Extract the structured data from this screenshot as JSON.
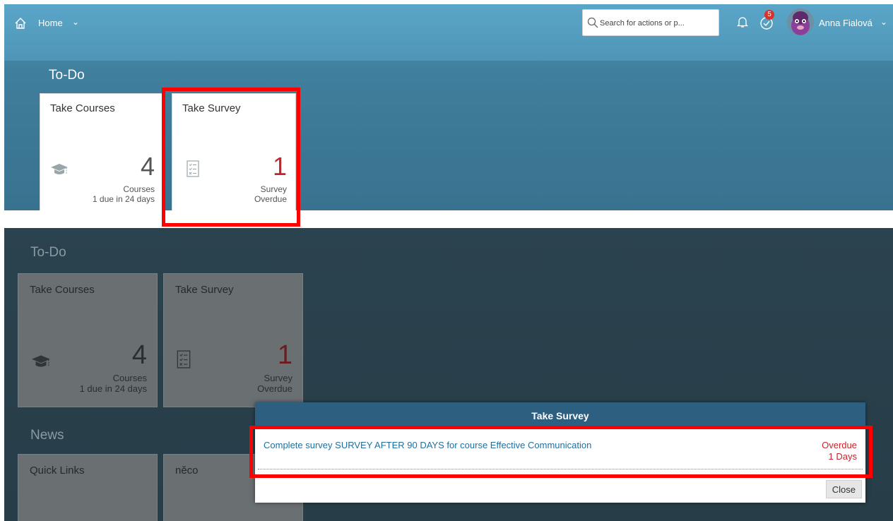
{
  "shell": {
    "home_label": "Home",
    "search_placeholder": "Search for actions or p...",
    "tasks_badge": "5",
    "user_name": "Anna Fialová"
  },
  "todo": {
    "section_title": "To-Do",
    "tiles": [
      {
        "title": "Take Courses",
        "number": "4",
        "sub1": "Courses",
        "sub2": "1 due in 24 days"
      },
      {
        "title": "Take Survey",
        "number": "1",
        "sub1": "Survey",
        "sub2": "Overdue"
      }
    ]
  },
  "news": {
    "section_title": "News",
    "tiles": [
      {
        "title": "Quick Links"
      },
      {
        "title": "něco"
      }
    ]
  },
  "dialog": {
    "title": "Take Survey",
    "items": [
      {
        "text": "Complete survey SURVEY AFTER 90 DAYS for course Effective Communication",
        "status1": "Overdue",
        "status2": "1 Days"
      }
    ],
    "close_label": "Close"
  },
  "colors": {
    "overdue": "#c8232c",
    "link": "#1e6fa0",
    "highlight": "#ff0000"
  }
}
